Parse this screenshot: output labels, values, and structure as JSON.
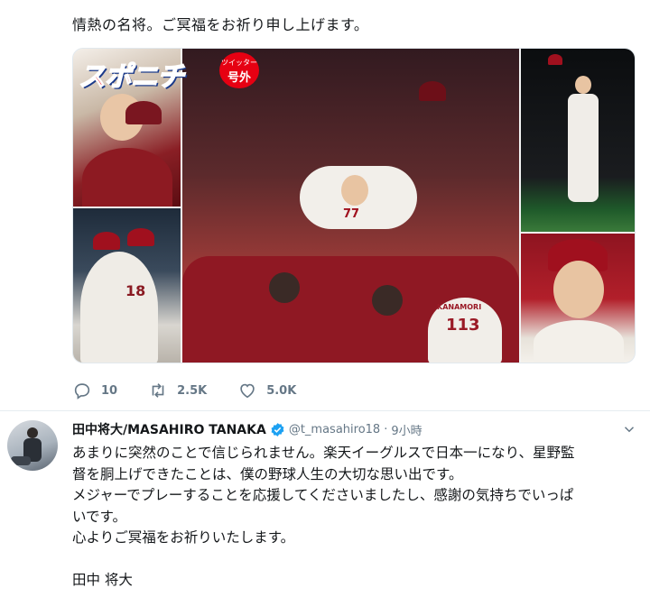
{
  "prev_tweet": {
    "text": "情熱の名将。ご冥福をお祈り申し上げます。",
    "media": {
      "logo_text": "スポニチ",
      "logo_badge_small": "ツイッター",
      "logo_badge_large": "号外"
    },
    "actions": {
      "reply_count": "10",
      "retweet_count": "2.5K",
      "like_count": "5.0K"
    }
  },
  "tweet": {
    "display_name": "田中将大/MASAHIRO TANAKA",
    "handle": "@t_masahiro18",
    "separator": "·",
    "time": "9小時",
    "lines": [
      "あまりに突然のことで信じられません。楽天イーグルスで日本一になり、星野監",
      "督を胴上げできたことは、僕の野球人生の大切な思い出です。",
      "メジャーでプレーすることを応援してくださいましたし、感謝の気持ちでいっぱ",
      "いです。",
      "心よりご冥福をお祈りいたします。",
      "",
      "田中 将大"
    ]
  },
  "colors": {
    "accent": "#1da1f2",
    "muted": "#657786",
    "brand_red": "#e60012"
  },
  "icons": [
    "reply-icon",
    "retweet-icon",
    "like-icon",
    "verified-icon",
    "chevron-down-icon"
  ]
}
